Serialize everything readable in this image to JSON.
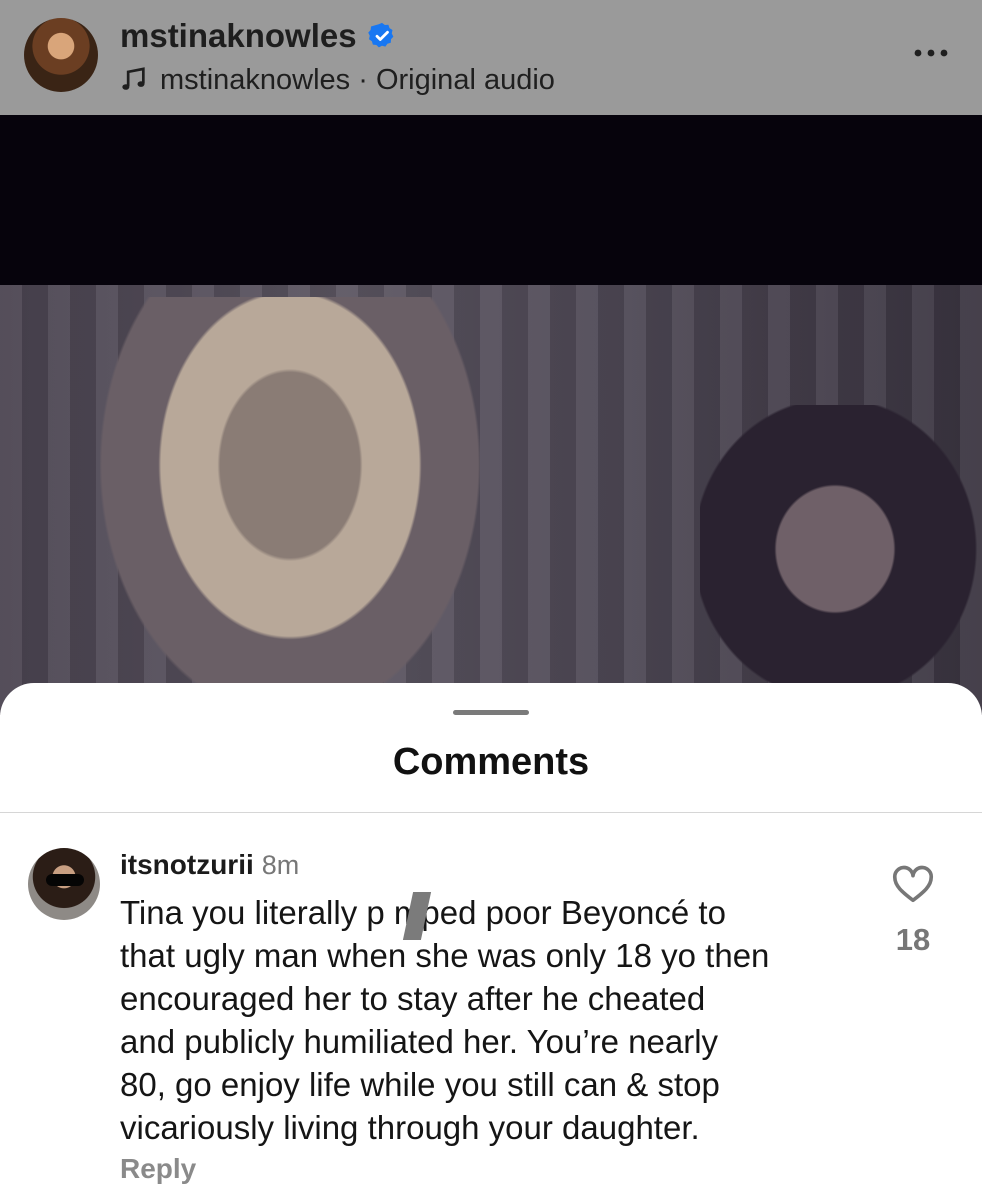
{
  "header": {
    "username": "mstinaknowles",
    "audio_label": "mstinaknowles · Original audio"
  },
  "icons": {
    "verified": "verified-badge-icon",
    "music": "music-note-icon",
    "more": "more-options-icon",
    "like": "heart-icon"
  },
  "sheet": {
    "title": "Comments"
  },
  "comment": {
    "username": "itsnotzurii",
    "time": "8m",
    "lines": [
      "Tina you literally p mped poor Beyoncé to",
      "that ugly man when she was only 18 yo then",
      "encouraged her to stay after he cheated",
      "and publicly humiliated her. You’re nearly",
      "80, go enjoy life while you still can & stop",
      "vicariously living through your daughter."
    ],
    "reply_label": "Reply",
    "likes": "18"
  },
  "colors": {
    "header_bg": "#9a9a9a",
    "verified_blue": "#1877f2",
    "video_bg": "#06030c",
    "muted_text": "#777777"
  }
}
